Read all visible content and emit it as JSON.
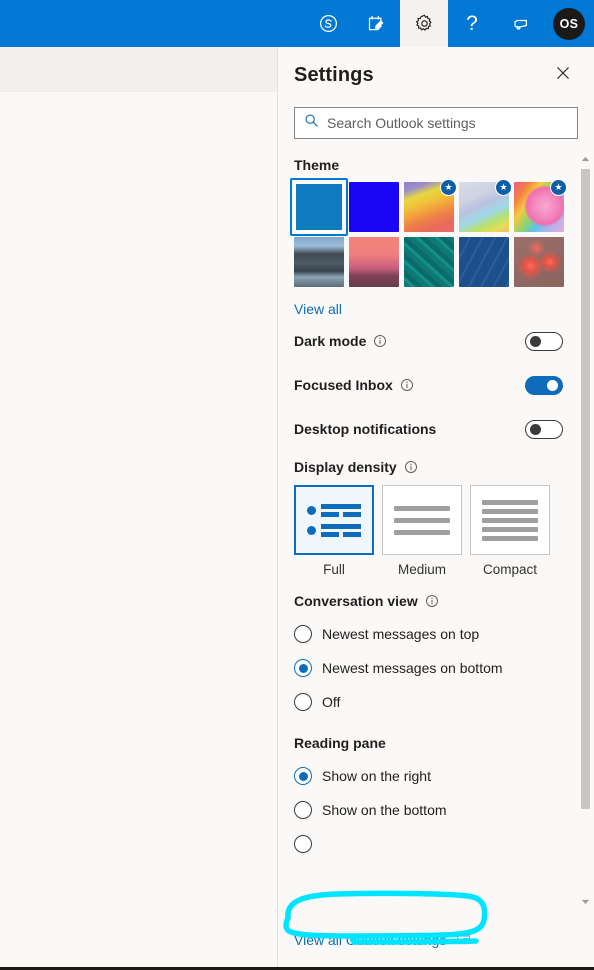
{
  "topbar": {
    "background": "#0078d4",
    "items": [
      {
        "name": "skype-icon",
        "label": "Skype"
      },
      {
        "name": "notes-icon",
        "label": "Notes"
      },
      {
        "name": "settings-gear-icon",
        "label": "Settings",
        "active": true
      },
      {
        "name": "help-icon",
        "label": "?"
      },
      {
        "name": "feedback-megaphone-icon",
        "label": "Feedback"
      }
    ],
    "avatar_initials": "OS"
  },
  "panel": {
    "title": "Settings",
    "close_label": "Close"
  },
  "search": {
    "placeholder": "Search Outlook settings",
    "value": ""
  },
  "theme": {
    "heading": "Theme",
    "view_all_label": "View all",
    "selected_index": 0,
    "swatches": [
      {
        "name": "theme-blue-solid",
        "premium": false,
        "selected": true
      },
      {
        "name": "theme-electric-blue",
        "premium": false,
        "selected": false
      },
      {
        "name": "theme-rainbow-waves",
        "premium": true,
        "selected": false
      },
      {
        "name": "theme-pastel-ribbons",
        "premium": true,
        "selected": false
      },
      {
        "name": "theme-unicorn",
        "premium": true,
        "selected": false
      },
      {
        "name": "theme-mountain-snow",
        "premium": false,
        "selected": false
      },
      {
        "name": "theme-palm-sunset",
        "premium": false,
        "selected": false
      },
      {
        "name": "theme-circuit-teal",
        "premium": false,
        "selected": false
      },
      {
        "name": "theme-innovation-blueprint",
        "premium": false,
        "selected": false
      },
      {
        "name": "theme-red-bokeh",
        "premium": false,
        "selected": false
      }
    ]
  },
  "toggles": [
    {
      "name": "dark-mode",
      "label": "Dark mode",
      "has_info": true,
      "on": false
    },
    {
      "name": "focused-inbox",
      "label": "Focused Inbox",
      "has_info": true,
      "on": true
    },
    {
      "name": "desktop-notifications",
      "label": "Desktop notifications",
      "has_info": false,
      "on": false
    }
  ],
  "display_density": {
    "heading": "Display density",
    "has_info": true,
    "selected": "Full",
    "options": [
      {
        "name": "full",
        "label": "Full",
        "selected": true
      },
      {
        "name": "medium",
        "label": "Medium",
        "selected": false
      },
      {
        "name": "compact",
        "label": "Compact",
        "selected": false
      }
    ]
  },
  "conversation_view": {
    "heading": "Conversation view",
    "has_info": true,
    "options": [
      {
        "name": "newest-on-top",
        "label": "Newest messages on top",
        "selected": false
      },
      {
        "name": "newest-on-bottom",
        "label": "Newest messages on bottom",
        "selected": true
      },
      {
        "name": "off",
        "label": "Off",
        "selected": false
      }
    ]
  },
  "reading_pane": {
    "heading": "Reading pane",
    "has_info": false,
    "options": [
      {
        "name": "show-on-right",
        "label": "Show on the right",
        "selected": true
      },
      {
        "name": "show-on-bottom",
        "label": "Show on the bottom",
        "selected": false
      },
      {
        "name": "hide",
        "label": "",
        "selected": false
      }
    ]
  },
  "footer": {
    "link_label": "View all Outlook settings",
    "link_icon": "open-in-new-window-icon"
  },
  "annotation": {
    "shape": "hand-drawn-circle",
    "color": "#00e5ff",
    "target": "View all Outlook settings"
  },
  "colors": {
    "accent": "#0078d4",
    "link": "#0f6cbd",
    "panel_bg": "#faf9f8",
    "text": "#201f1e"
  }
}
